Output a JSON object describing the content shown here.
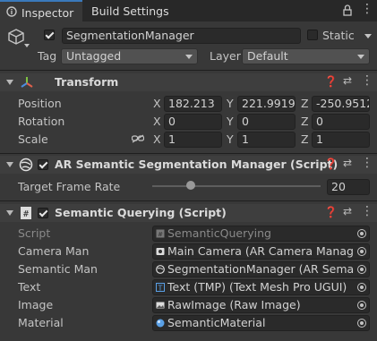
{
  "tabs": {
    "inspector": "Inspector",
    "build_settings": "Build Settings"
  },
  "object": {
    "name": "SegmentationManager",
    "static_label": "Static",
    "tag_label": "Tag",
    "tag_value": "Untagged",
    "layer_label": "Layer",
    "layer_value": "Default"
  },
  "transform": {
    "title": "Transform",
    "position_label": "Position",
    "rotation_label": "Rotation",
    "scale_label": "Scale",
    "axis_x": "X",
    "axis_y": "Y",
    "axis_z": "Z",
    "position": {
      "x": "182.213",
      "y": "221.9919",
      "z": "-250.9512"
    },
    "rotation": {
      "x": "0",
      "y": "0",
      "z": "0"
    },
    "scale": {
      "x": "1",
      "y": "1",
      "z": "1"
    }
  },
  "segmentation": {
    "title": "AR Semantic Segmentation Manager (Script)",
    "frame_rate_label": "Target Frame Rate",
    "frame_rate_value": "20",
    "frame_rate_fraction": 0.2
  },
  "querying": {
    "title": "Semantic Querying (Script)",
    "fields": [
      {
        "label": "Script",
        "value": "SemanticQuerying",
        "icon": "script-icon",
        "disabled": true
      },
      {
        "label": "Camera Man",
        "value": "Main Camera (AR Camera Manager)",
        "icon": "camera-manager-icon",
        "disabled": false
      },
      {
        "label": "Semantic Man",
        "value": "SegmentationManager (AR Semantic",
        "icon": "segmentation-icon",
        "disabled": false
      },
      {
        "label": "Text",
        "value": "Text (TMP) (Text Mesh Pro UGUI)",
        "icon": "text-icon",
        "disabled": false
      },
      {
        "label": "Image",
        "value": "RawImage (Raw Image)",
        "icon": "raw-image-icon",
        "disabled": false
      },
      {
        "label": "Material",
        "value": "SemanticMaterial",
        "icon": "material-icon",
        "disabled": false
      }
    ]
  },
  "colors": {
    "background": "#383838",
    "tab_accent": "#3a79bb",
    "field": "#2a2a2a"
  }
}
